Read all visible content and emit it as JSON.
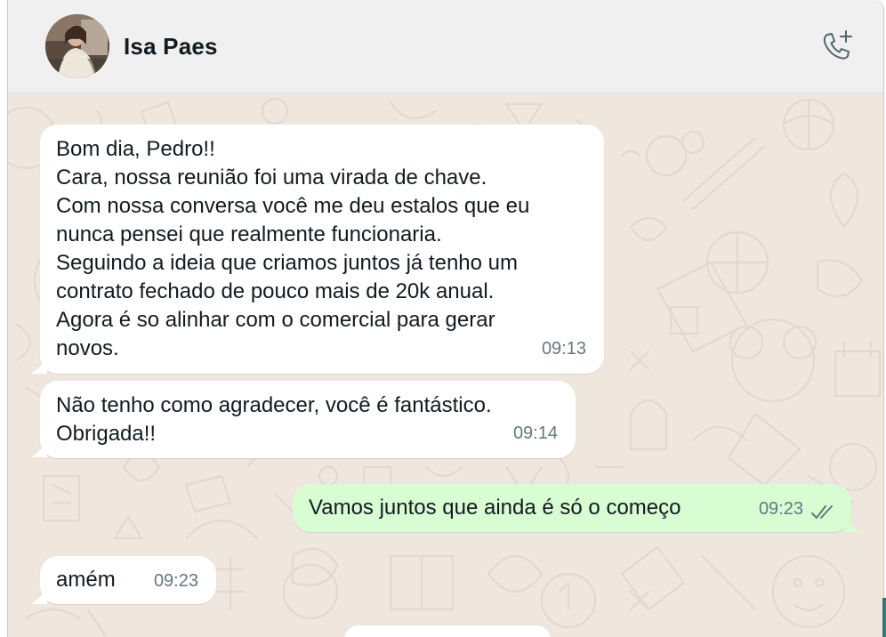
{
  "contact": {
    "name": "Isa Paes",
    "avatar_icon": "contact-photo",
    "call_icon": "phone-add-icon"
  },
  "colors": {
    "header_bg": "#f0f0f0",
    "chat_bg": "#efe7de",
    "incoming_bubble": "#ffffff",
    "outgoing_bubble": "#d9fdd3",
    "time_text": "#667781",
    "read_ticks": "#667781"
  },
  "messages": [
    {
      "direction": "in",
      "text": "Bom dia, Pedro!!\nCara, nossa reunião foi uma virada de chave.\nCom nossa conversa você me deu estalos que eu\nnunca pensei que realmente funcionaria.\nSeguindo a ideia que criamos juntos já tenho um\ncontrato fechado de pouco mais de 20k anual.\nAgora é so alinhar com o comercial para gerar\nnovos.",
      "time": "09:13"
    },
    {
      "direction": "in",
      "text": "Não tenho como agradecer, você é fantástico.\nObrigada!!",
      "time": "09:14"
    },
    {
      "direction": "out",
      "text": "Vamos juntos que ainda é só o começo",
      "time": "09:23",
      "status_icon": "double-check-icon"
    },
    {
      "direction": "in",
      "text": "amém",
      "time": "09:23"
    }
  ]
}
